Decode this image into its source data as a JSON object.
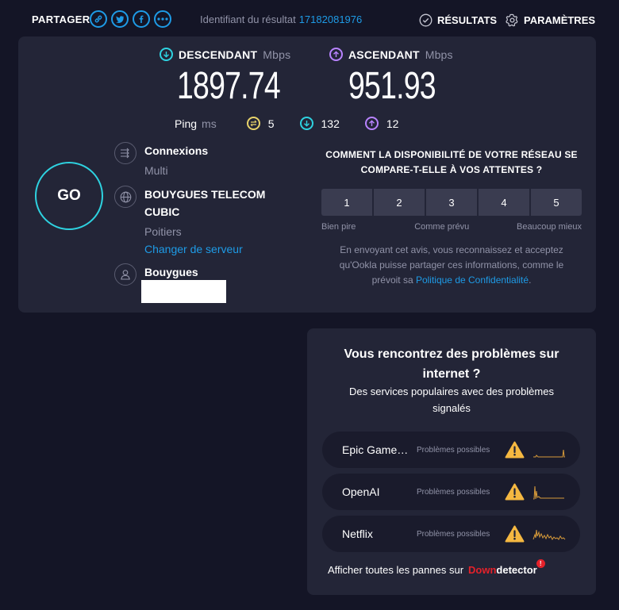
{
  "topbar": {
    "share_label": "PARTAGER",
    "share_icons": [
      "link-icon",
      "twitter-icon",
      "facebook-icon",
      "more-icon"
    ],
    "result_id_label": "Identifiant du résultat",
    "result_id": "17182081976",
    "results_label": "RÉSULTATS",
    "settings_label": "PARAMÈTRES"
  },
  "download": {
    "label": "DESCENDANT",
    "unit": "Mbps",
    "value": "1897.74",
    "color": "#2ed2e0"
  },
  "upload": {
    "label": "ASCENDANT",
    "unit": "Mbps",
    "value": "951.93",
    "color": "#b883ff"
  },
  "ping": {
    "label": "Ping",
    "unit": "ms",
    "idle": "5",
    "download": "132",
    "upload": "12",
    "idle_color": "#e8d36a"
  },
  "go_label": "GO",
  "connections": {
    "title": "Connexions",
    "value": "Multi"
  },
  "server": {
    "name_line1": "BOUYGUES TELECOM",
    "name_line2": "CUBIC",
    "location": "Poitiers",
    "change_link": "Changer de serveur"
  },
  "isp": {
    "name": "Bouygues"
  },
  "survey": {
    "question_line1": "COMMENT LA DISPONIBILITÉ DE VOTRE RÉSEAU SE",
    "question_line2": "COMPARE-T-ELLE À VOS ATTENTES ?",
    "ratings": [
      "1",
      "2",
      "3",
      "4",
      "5"
    ],
    "label_low": "Bien pire",
    "label_mid": "Comme prévu",
    "label_high": "Beaucoup mieux",
    "note_line1": "En envoyant cet avis, vous reconnaissez et acceptez",
    "note_line2": "qu'Ookla puisse partager ces informations, comme le",
    "note_line3_prefix": "prévoit sa ",
    "note_link": "Politique de Confidentialité",
    "note_suffix": "."
  },
  "downdetector": {
    "title_line1": "Vous rencontrez des problèmes sur",
    "title_line2": "internet ?",
    "subtitle_line1": "Des services populaires avec des problèmes",
    "subtitle_line2": "signalés",
    "services": [
      {
        "name": "Epic Games Store",
        "status": "Problèmes possibles"
      },
      {
        "name": "OpenAI",
        "status": "Problèmes possibles"
      },
      {
        "name": "Netflix",
        "status": "Problèmes possibles"
      }
    ],
    "footer_text": "Afficher toutes les pannes sur",
    "logo_down": "Down",
    "logo_detector": "detector",
    "badge": "!",
    "warn_color": "#f5b841",
    "spark_color": "#d69a3a"
  }
}
